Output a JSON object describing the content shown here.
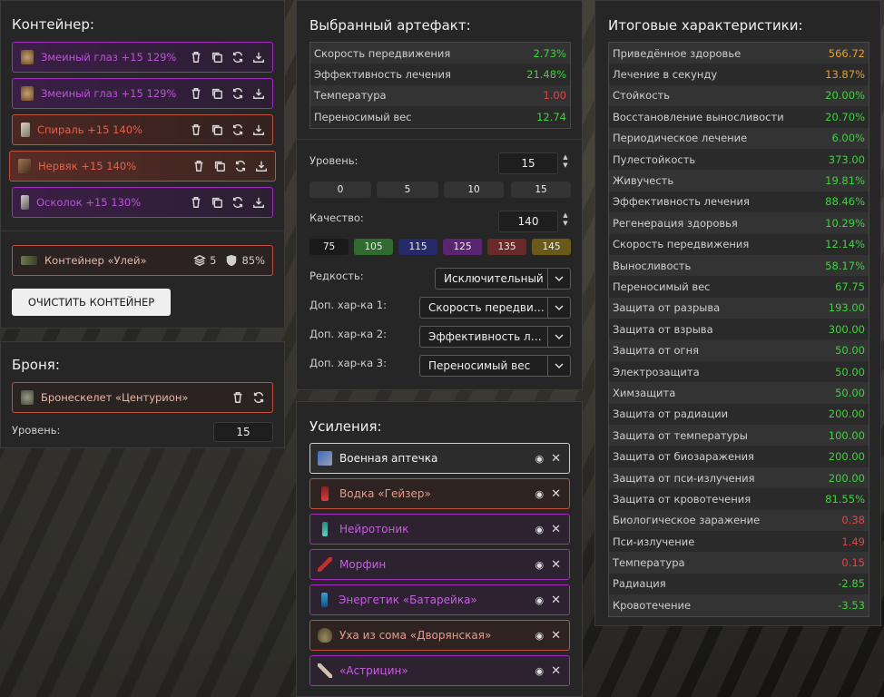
{
  "container": {
    "title": "Контейнер:",
    "slots": [
      {
        "name": "Змеиный глаз +15 129%",
        "rarity": "purple"
      },
      {
        "name": "Змеиный глаз +15 129%",
        "rarity": "purple"
      },
      {
        "name": "Спираль +15 140%",
        "rarity": "orange"
      },
      {
        "name": "Нервяк +15 140%",
        "rarity": "orange"
      },
      {
        "name": "Осколок +15 130%",
        "rarity": "purple"
      }
    ],
    "item": {
      "name": "Контейнер «Улей»",
      "slots_count": "5",
      "protection": "85%"
    },
    "clear_button": "ОЧИСТИТЬ КОНТЕЙНЕР"
  },
  "armor": {
    "title": "Броня:",
    "item": "Бронескелет «Центурион»",
    "level_label": "Уровень:",
    "level_value": "15"
  },
  "artifact": {
    "title": "Выбранный артефакт:",
    "stats": [
      {
        "label": "Скорость передвижения",
        "value": "2.73%",
        "color": "g"
      },
      {
        "label": "Эффективность лечения",
        "value": "21.48%",
        "color": "g"
      },
      {
        "label": "Температура",
        "value": "1.00",
        "color": "r"
      },
      {
        "label": "Переносимый вес",
        "value": "12.74",
        "color": "g"
      }
    ],
    "level_label": "Уровень:",
    "level_value": "15",
    "level_presets": [
      "0",
      "5",
      "10",
      "15"
    ],
    "quality_label": "Качество:",
    "quality_value": "140",
    "quality_presets": [
      "75",
      "105",
      "115",
      "125",
      "135",
      "145"
    ],
    "rarity_label": "Редкость:",
    "rarity_value": "Исключительный",
    "extra1_label": "Доп. хар-ка 1:",
    "extra1_value": "Скорость передвижения",
    "extra2_label": "Доп. хар-ка 2:",
    "extra2_value": "Эффективность лечения",
    "extra3_label": "Доп. хар-ка 3:",
    "extra3_value": "Переносимый вес"
  },
  "boosts": {
    "title": "Усиления:",
    "items": [
      {
        "name": "Военная аптечка",
        "style": "white"
      },
      {
        "name": "Водка «Гейзер»",
        "style": "orange"
      },
      {
        "name": "Нейротоник",
        "style": "purple"
      },
      {
        "name": "Морфин",
        "style": "purple"
      },
      {
        "name": "Энергетик «Батарейка»",
        "style": "purple"
      },
      {
        "name": "Уха из сома «Дворянская»",
        "style": "orange"
      },
      {
        "name": "«Астрицин»",
        "style": "purple"
      }
    ]
  },
  "totals": {
    "title": "Итоговые характеристики:",
    "stats": [
      {
        "label": "Приведённое здоровье",
        "value": "566.72",
        "color": "o"
      },
      {
        "label": "Лечение в секунду",
        "value": "13.87%",
        "color": "o"
      },
      {
        "label": "Стойкость",
        "value": "20.00%",
        "color": "g"
      },
      {
        "label": "Восстановление выносливости",
        "value": "20.70%",
        "color": "g"
      },
      {
        "label": "Периодическое лечение",
        "value": "6.00%",
        "color": "g"
      },
      {
        "label": "Пулестойкость",
        "value": "373.00",
        "color": "g"
      },
      {
        "label": "Живучесть",
        "value": "19.81%",
        "color": "g"
      },
      {
        "label": "Эффективность лечения",
        "value": "88.46%",
        "color": "g"
      },
      {
        "label": "Регенерация здоровья",
        "value": "10.29%",
        "color": "g"
      },
      {
        "label": "Скорость передвижения",
        "value": "12.14%",
        "color": "g"
      },
      {
        "label": "Выносливость",
        "value": "58.17%",
        "color": "g"
      },
      {
        "label": "Переносимый вес",
        "value": "67.75",
        "color": "g"
      },
      {
        "label": "Защита от разрыва",
        "value": "193.00",
        "color": "g"
      },
      {
        "label": "Защита от взрыва",
        "value": "300.00",
        "color": "g"
      },
      {
        "label": "Защита от огня",
        "value": "50.00",
        "color": "g"
      },
      {
        "label": "Электрозащита",
        "value": "50.00",
        "color": "g"
      },
      {
        "label": "Химзащита",
        "value": "50.00",
        "color": "g"
      },
      {
        "label": "Защита от радиации",
        "value": "200.00",
        "color": "g"
      },
      {
        "label": "Защита от температуры",
        "value": "100.00",
        "color": "g"
      },
      {
        "label": "Защита от биозаражения",
        "value": "200.00",
        "color": "g"
      },
      {
        "label": "Защита от пси-излучения",
        "value": "200.00",
        "color": "g"
      },
      {
        "label": "Защита от кровотечения",
        "value": "81.55%",
        "color": "g"
      },
      {
        "label": "Биологическое заражение",
        "value": "0.38",
        "color": "r"
      },
      {
        "label": "Пси-излучение",
        "value": "1.49",
        "color": "r"
      },
      {
        "label": "Температура",
        "value": "0.15",
        "color": "r"
      },
      {
        "label": "Радиация",
        "value": "-2.85",
        "color": "g"
      },
      {
        "label": "Кровотечение",
        "value": "-3.53",
        "color": "g"
      }
    ]
  },
  "colors": {
    "green": "#3ed33e",
    "orange": "#e6a12a",
    "red": "#e04646",
    "purple": "#a52ac2",
    "rare_orange": "#c1503c"
  }
}
